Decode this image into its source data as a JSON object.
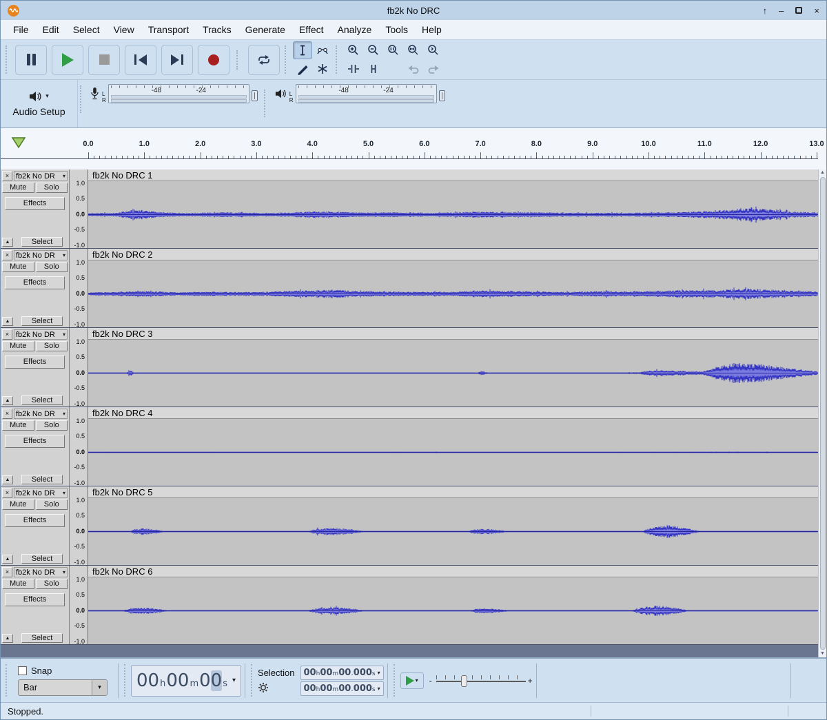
{
  "window": {
    "title": "fb2k No DRC",
    "controls": {
      "keep_above": "↑",
      "minimize": "–",
      "close": "×"
    }
  },
  "glyphs": {
    "caret": "▾"
  },
  "menu": {
    "items": [
      "File",
      "Edit",
      "Select",
      "View",
      "Transport",
      "Tracks",
      "Generate",
      "Effect",
      "Analyze",
      "Tools",
      "Help"
    ]
  },
  "audio_setup": {
    "label": "Audio Setup"
  },
  "meters": {
    "channels": [
      "L",
      "R"
    ],
    "recording": {
      "ticks": [
        "-48",
        "-24"
      ]
    },
    "playback": {
      "ticks": [
        "-48",
        "-24"
      ]
    }
  },
  "timeline": {
    "labels": [
      "0.0",
      "1.0",
      "2.0",
      "3.0",
      "4.0",
      "5.0",
      "6.0",
      "7.0",
      "8.0",
      "9.0",
      "10.0",
      "11.0",
      "12.0",
      "13.0"
    ]
  },
  "track_ui": {
    "mute": "Mute",
    "solo": "Solo",
    "effects": "Effects",
    "select": "Select",
    "scale": [
      "1.0",
      "0.5",
      "0.0",
      "-0.5",
      "-1.0"
    ],
    "close_glyph": "×",
    "dropdown_glyph": "▾",
    "collapse_glyph": "▲"
  },
  "tracks": [
    {
      "name": "fb2k No DRC 1",
      "short_name": "fb2k No DR",
      "focused": true,
      "envelope": [
        [
          0,
          0.05
        ],
        [
          0.5,
          0.06
        ],
        [
          0.85,
          0.17
        ],
        [
          1.05,
          0.14
        ],
        [
          1.35,
          0.07
        ],
        [
          1.9,
          0.06
        ],
        [
          2.5,
          0.08
        ],
        [
          3.1,
          0.06
        ],
        [
          3.6,
          0.07
        ],
        [
          4.1,
          0.11
        ],
        [
          4.5,
          0.09
        ],
        [
          5.0,
          0.07
        ],
        [
          5.6,
          0.08
        ],
        [
          6.2,
          0.06
        ],
        [
          6.9,
          0.1
        ],
        [
          7.4,
          0.09
        ],
        [
          8.0,
          0.08
        ],
        [
          8.6,
          0.06
        ],
        [
          9.2,
          0.06
        ],
        [
          9.9,
          0.07
        ],
        [
          10.5,
          0.08
        ],
        [
          11.2,
          0.13
        ],
        [
          11.7,
          0.22
        ],
        [
          12.1,
          0.19
        ],
        [
          12.5,
          0.12
        ],
        [
          13.05,
          0.07
        ]
      ]
    },
    {
      "name": "fb2k No DRC 2",
      "short_name": "fb2k No DR",
      "focused": false,
      "envelope": [
        [
          0,
          0.05
        ],
        [
          0.6,
          0.07
        ],
        [
          1.0,
          0.09
        ],
        [
          1.6,
          0.06
        ],
        [
          2.2,
          0.07
        ],
        [
          2.8,
          0.06
        ],
        [
          3.4,
          0.08
        ],
        [
          4.0,
          0.12
        ],
        [
          4.4,
          0.14
        ],
        [
          4.8,
          0.1
        ],
        [
          5.3,
          0.08
        ],
        [
          5.9,
          0.07
        ],
        [
          6.5,
          0.07
        ],
        [
          7.0,
          0.12
        ],
        [
          7.4,
          0.1
        ],
        [
          8.0,
          0.08
        ],
        [
          8.6,
          0.07
        ],
        [
          9.2,
          0.09
        ],
        [
          9.7,
          0.08
        ],
        [
          10.2,
          0.1
        ],
        [
          10.7,
          0.13
        ],
        [
          11.2,
          0.12
        ],
        [
          11.7,
          0.17
        ],
        [
          12.1,
          0.15
        ],
        [
          12.6,
          0.1
        ],
        [
          13.05,
          0.08
        ]
      ]
    },
    {
      "name": "fb2k No DRC 3",
      "short_name": "fb2k No DR",
      "focused": false,
      "envelope": [
        [
          0,
          0.012
        ],
        [
          0.68,
          0.012
        ],
        [
          0.75,
          0.1
        ],
        [
          0.82,
          0.012
        ],
        [
          3.0,
          0.012
        ],
        [
          6.95,
          0.012
        ],
        [
          7.05,
          0.08
        ],
        [
          7.15,
          0.012
        ],
        [
          9.0,
          0.012
        ],
        [
          9.85,
          0.03
        ],
        [
          10.15,
          0.1
        ],
        [
          10.55,
          0.08
        ],
        [
          11.0,
          0.06
        ],
        [
          11.3,
          0.24
        ],
        [
          11.6,
          0.38
        ],
        [
          12.0,
          0.3
        ],
        [
          12.4,
          0.2
        ],
        [
          12.8,
          0.11
        ],
        [
          13.05,
          0.06
        ]
      ]
    },
    {
      "name": "fb2k No DRC 4",
      "short_name": "fb2k No DR",
      "focused": false,
      "envelope": [
        [
          0,
          0.015
        ],
        [
          2,
          0.02
        ],
        [
          4,
          0.015
        ],
        [
          6,
          0.018
        ],
        [
          8,
          0.015
        ],
        [
          10,
          0.02
        ],
        [
          11.5,
          0.025
        ],
        [
          13.05,
          0.015
        ]
      ]
    },
    {
      "name": "fb2k No DRC 5",
      "short_name": "fb2k No DR",
      "focused": false,
      "envelope": [
        [
          0,
          0.01
        ],
        [
          0.7,
          0.01
        ],
        [
          0.85,
          0.08
        ],
        [
          1.0,
          0.11
        ],
        [
          1.2,
          0.07
        ],
        [
          1.4,
          0.01
        ],
        [
          3.9,
          0.01
        ],
        [
          4.1,
          0.1
        ],
        [
          4.4,
          0.13
        ],
        [
          4.7,
          0.08
        ],
        [
          4.95,
          0.01
        ],
        [
          6.75,
          0.01
        ],
        [
          6.95,
          0.08
        ],
        [
          7.15,
          0.09
        ],
        [
          7.35,
          0.05
        ],
        [
          7.55,
          0.01
        ],
        [
          9.9,
          0.01
        ],
        [
          10.1,
          0.16
        ],
        [
          10.4,
          0.22
        ],
        [
          10.7,
          0.12
        ],
        [
          10.95,
          0.01
        ],
        [
          13.05,
          0.01
        ]
      ]
    },
    {
      "name": "fb2k No DRC 6",
      "short_name": "fb2k No DR",
      "focused": false,
      "envelope": [
        [
          0,
          0.01
        ],
        [
          0.6,
          0.01
        ],
        [
          0.8,
          0.09
        ],
        [
          1.0,
          0.11
        ],
        [
          1.25,
          0.06
        ],
        [
          1.45,
          0.01
        ],
        [
          3.9,
          0.01
        ],
        [
          4.15,
          0.11
        ],
        [
          4.45,
          0.12
        ],
        [
          4.75,
          0.07
        ],
        [
          4.95,
          0.01
        ],
        [
          6.8,
          0.01
        ],
        [
          7.0,
          0.09
        ],
        [
          7.2,
          0.08
        ],
        [
          7.4,
          0.04
        ],
        [
          7.6,
          0.01
        ],
        [
          9.7,
          0.01
        ],
        [
          9.95,
          0.13
        ],
        [
          10.2,
          0.18
        ],
        [
          10.5,
          0.1
        ],
        [
          10.75,
          0.01
        ],
        [
          13.05,
          0.01
        ]
      ]
    }
  ],
  "bottom": {
    "snap_label": "Snap",
    "snap_mode": "Bar",
    "time_main": "00h00m00s",
    "selection_label": "Selection",
    "selection_start": "00h00m00.000s",
    "selection_end": "00h00m00.000s",
    "speed_minus": "-",
    "speed_plus": "+"
  },
  "status": {
    "text": "Stopped."
  },
  "colors": {
    "wave": "#3636c4",
    "wave_rms": "#7b7bdf",
    "focus_border": "#dcc96b"
  }
}
